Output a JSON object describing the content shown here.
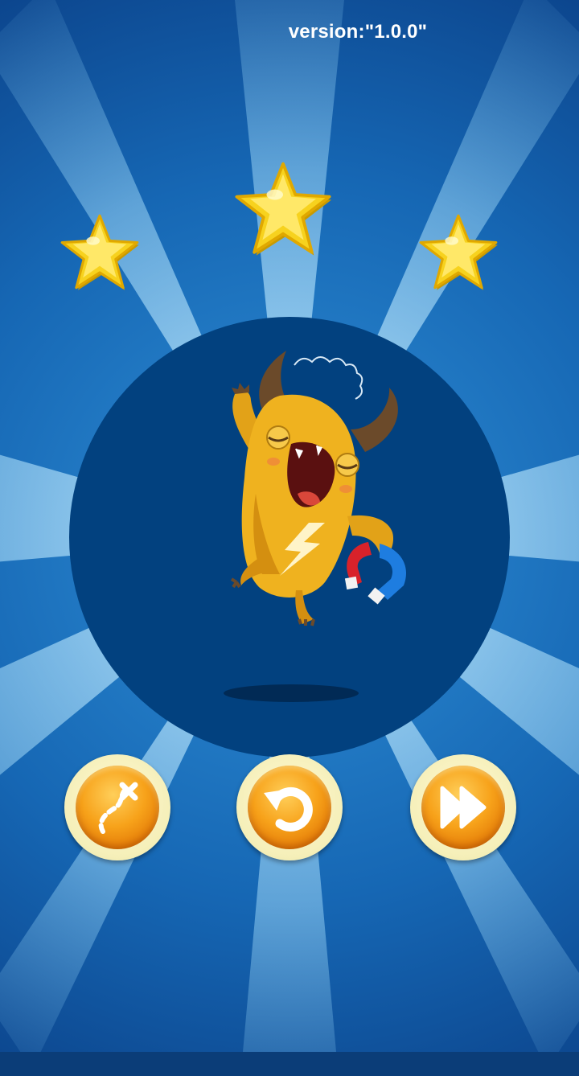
{
  "version_label": "version:\"1.0.0\"",
  "stars": {
    "earned": 3,
    "total": 3,
    "color": "#f7d21e"
  },
  "colors": {
    "background": "#0f5aa6",
    "circle": "#02417f",
    "button_orange": "#f7a21a",
    "button_ring": "#f5efb8"
  },
  "buttons": [
    {
      "name": "map-button",
      "icon": "map-path-icon"
    },
    {
      "name": "retry-button",
      "icon": "retry-icon"
    },
    {
      "name": "next-button",
      "icon": "fast-forward-icon"
    }
  ],
  "character": {
    "icon": "monster-with-magnet-icon"
  }
}
